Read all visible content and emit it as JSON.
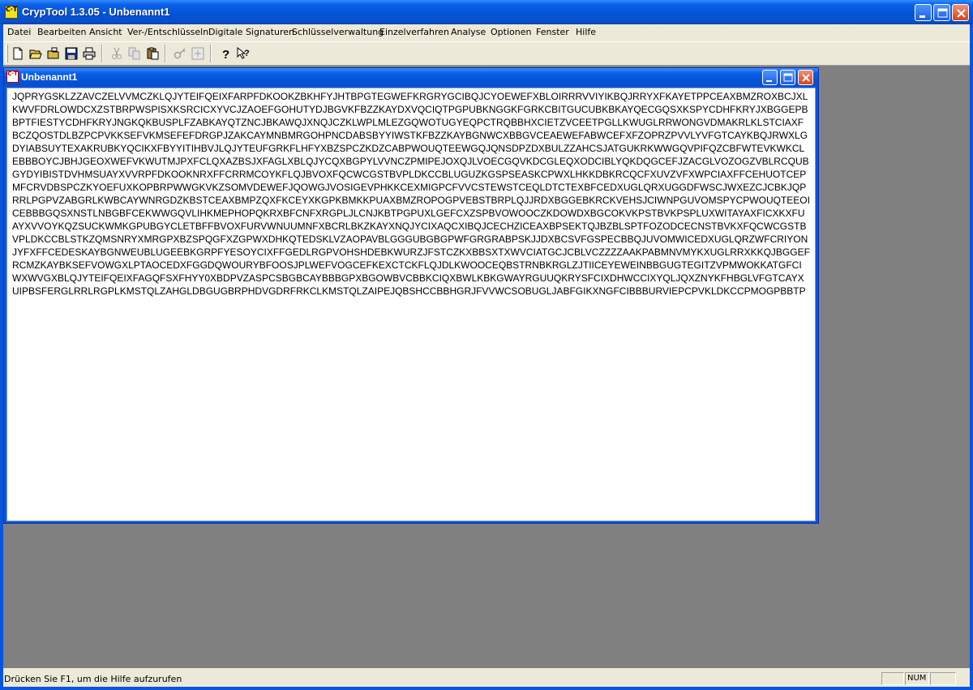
{
  "app": {
    "title": "CrypTool 1.3.05 - Unbenannt1",
    "icon_text": "C·T",
    "icon": "cryptool-app-icon"
  },
  "title_buttons": [
    "minimize-icon",
    "maximize-icon",
    "close-icon"
  ],
  "menu": {
    "items": [
      "Datei",
      "Bearbeiten",
      "Ansicht",
      "Ver-/Entschlüsseln",
      "Digitale Signaturen",
      "Schlüsselverwaltung",
      "Einzelverfahren",
      "Analyse",
      "Optionen",
      "Fenster",
      "Hilfe"
    ]
  },
  "toolbar": {
    "buttons": [
      {
        "icon": "new-document-icon",
        "enabled": true
      },
      {
        "icon": "open-folder-icon",
        "enabled": true
      },
      {
        "icon": "open-plain-icon",
        "enabled": true
      },
      {
        "icon": "save-icon",
        "enabled": true
      },
      {
        "icon": "print-icon",
        "enabled": true
      },
      {
        "icon": "cut-icon",
        "enabled": false
      },
      {
        "icon": "copy-icon",
        "enabled": false
      },
      {
        "icon": "paste-icon",
        "enabled": true
      },
      {
        "icon": "key-icon",
        "enabled": false
      },
      {
        "icon": "key-show-icon",
        "enabled": false
      },
      {
        "icon": "help-icon",
        "enabled": true
      },
      {
        "icon": "context-help-icon",
        "enabled": true
      }
    ]
  },
  "document": {
    "title": "Unbenannt1",
    "icon_text": "C·T",
    "text": "JQPRYGSKLZZAVCZELVVMCZKLQJYTEIFQEIXFARPFDKOOKZBKHFYJHTBPGTEGWEFKRGRYGCIBQJCYOEWEFXBLOIRRRVVIYIKBQJRRYXFKAYETPPCEAXBMZROXBCJXLKWVFDRLOWDCXZSTBRPWSPISXKSRCICXYVCJZAOEFGOHUTYDJBGVKFBZZKAYDXVQCIQTPGPUBKNGGKFGRKCBITGUCUBKBKAYQECGQSXKSPYCDHFKRYJXBGGEPBBPTFIESTYCDHFKRYJNGKQKBUSPLFZABKAYQTZNCJBKAWQJXNQJCZKLWPLMLEZGQWOTUGYEQPCTRQBBHXCIETZVCEETPGLLKWUGLRRWONGVDMAKRLKLSTCIAXFBCZQOSTDLBZPCPVKKSEFVKMSEFEFDRGPJZAKCAYMNBMRGOHPNCDABSBYYIWSTKFBZZKAYBGNWCXBBGVCEAEWEFABWCEFXFZOPRZPVVLYVFGTCAYKBQJRWXLGDYIABSUYTEXAKRUBKYQCIKXFBYYITIHBVJLQJYTEUFGRKFLHFYXBZSPCZKDZCABPWOUQTEEWGQJQNSDPZDXBULZZAHCSJATGUKRKWWGQVPIFQZCBFWTEVKWKCLEBBBOYCJBHJGEOXWEFVKWUTMJPXFCLQXAZBSJXFAGLXBLQJYCQXBGPYLVVNCZPMIPEJOXQJLVOECGQVKDCGLEQXODCIBLYQKDQGCEFJZACGLVOZOGZVBLRCQUBGYDYIBISTDVHMSUAYXVVRPFDKOOKNRXFFCRRMCOYKFLQJBVOXFQCWCGSTBVPLDKCCBLUGUZKGSPSEASKCPWXLHKKDBKRCQCFXUVZVFXWPCIAXFFCEHUOTCEPMFCRVDBSPCZKYOEFUXKOPBRPWWGKVKZSOMVDEWEFJQOWGJVOSIGEVPHKKCEXMIGPCFVVCSTEWSTCEQLDTCTEXBFCEDXUGLQRXUGGDFWSCJWXEZCJCBKJQPRRLPGPVZABGRLKWBCAYWNRGDZKBSTCEAXBMPZQXFKCEYXKGPKBMKKPUAXBMZROPOGPVEBSTBRPLQJJRDXBGGEBKRCKVEHSJCIWNPGUVOMSPYCPWOUQTEEOICEBBBGQSXNSTLNBGBFCEKWWGQVLIHKMEPHOPQKRXBFCNFXRGPLJLCNJKBTPGPUXLGEFCXZSPBVOWOOCZKDOWDXBGCOKVKPSTBVKPSPLUXWITAYAXFICXKXFUAYXVVOYKQZSUCKWMKGPUBGYCLETBFFBVOXFURVWNUUMNFXBCRLBKZKAYXNQJYCIXAQCXIBQJCECHZICEAXBPSEKTQJBZBLSPTFOZODCECNSTBVKXFQCWCGSTBVPLDKCCBLSTKZQMSNRYXMRGPXBZSPQGFXZGPWXDHKQTEDSKLVZAOPAVBLGGGUBGBGPWFGRGRABPSKJJDXBCSVFGSPECBBQJUVOMWICEDXUGLQRZWFCRIYONJYFXFFCEDESKAYBGNWEUBLUGEEBKGRPFYESOYCIXFFGEDLRGPVOHSHDEBKWURZJFSTCZKXBBSXTXWVCIATGCJCBLVCZZZZAAKPABMNVMYKXUGLRRXKKQJBGGEFRCMZKAYBKSEFVOWGXLPTAOCEDXFGGDQWOURYBFOOSJPLWEFVOGCEFKEXCTCKFLQJDLKWOOCEQBSTRNBKRGLZJTIICEYEWEINBBGUGTEGITZVPMWOKKATGFCIWXWVGXBLQJYTEIFQEIXFAGQFSXFHYY0XBDPVZASPCSBGBCAYBBBGPXBGOWBVCBBKCIQXBWLKBKGWAYRGUUQKRYSFCIXDHWCCIXYQLJQXZNYKFHBGLVFGTCAYXUIPBSFERGLRRLRGPLKMSTQLZAHGLDBGUGBRPHDVGDRFRKCLKMSTQLZAIPEJQBSHCCBBHGRJFVVWCSOBUGLJABFGIKXNGFCIBBBURVIEPCPVKLDKCCPMOGPBBTP"
  },
  "status": {
    "text": "Drücken Sie F1, um die Hilfe aufzurufen",
    "panes": [
      "",
      "NUM",
      ""
    ]
  }
}
